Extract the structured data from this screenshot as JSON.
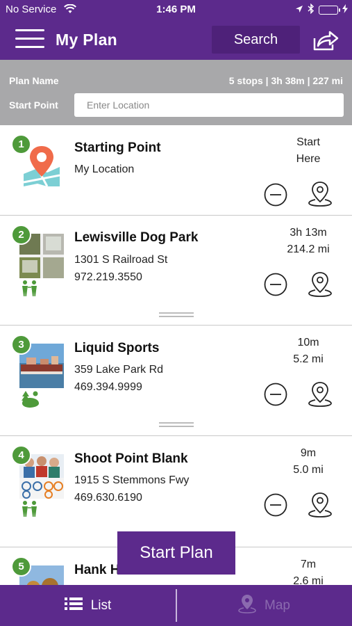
{
  "status_bar": {
    "carrier": "No Service",
    "time": "1:46 PM"
  },
  "nav": {
    "title": "My Plan",
    "search_label": "Search"
  },
  "plan": {
    "name_label": "Plan Name",
    "summary": "5 stops | 3h 38m | 227 mi",
    "start_point_label": "Start Point",
    "location_placeholder": "Enter Location",
    "location_value": ""
  },
  "stops": [
    {
      "number": "1",
      "name": "Starting Point",
      "line1": "My Location",
      "line2": "",
      "time1": "Start",
      "time2": "Here"
    },
    {
      "number": "2",
      "name": "Lewisville Dog Park",
      "line1": "1301 S Railroad St",
      "line2": "972.219.3550",
      "time1": "3h 13m",
      "time2": "214.2 mi"
    },
    {
      "number": "3",
      "name": "Liquid Sports",
      "line1": "359 Lake Park Rd",
      "line2": "469.394.9999",
      "time1": "10m",
      "time2": "5.2 mi"
    },
    {
      "number": "4",
      "name": "Shoot Point Blank",
      "line1": "1915 S Stemmons Fwy",
      "line2": "469.630.6190",
      "time1": "9m",
      "time2": "5.0 mi"
    },
    {
      "number": "5",
      "name": "Hank H",
      "line1": "",
      "line2": "",
      "time1": "7m",
      "time2": "2.6 mi"
    }
  ],
  "start_plan_label": "Start Plan",
  "tabs": {
    "list": "List",
    "map": "Map"
  },
  "colors": {
    "brand_purple": "#5c2a8c",
    "badge_green": "#4e9a3a",
    "header_gray": "#a8a8aa"
  },
  "icons": {
    "location_pin": "location-pin-icon",
    "remove": "minus-circle-icon",
    "map_pin": "map-pin-icon",
    "family": "family-icon",
    "outdoors": "outdoors-icon",
    "share": "share-icon",
    "menu": "hamburger-menu-icon",
    "list": "list-icon"
  }
}
